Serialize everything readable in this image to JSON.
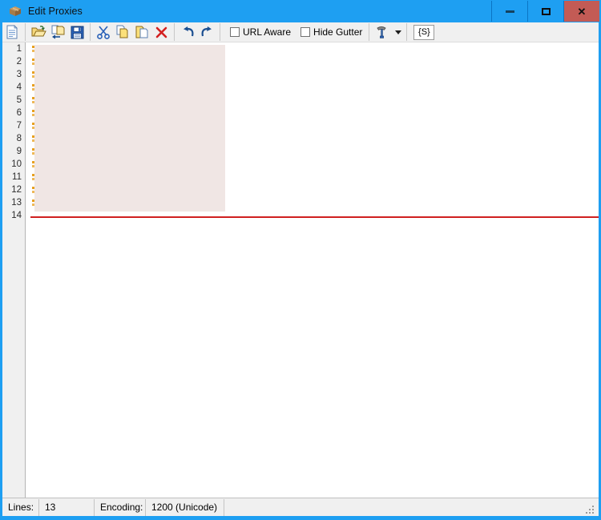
{
  "window": {
    "title": "Edit Proxies",
    "icon": "package-box-icon",
    "accent_color": "#1e9ff2",
    "close_button_color": "#c35b55",
    "controls": {
      "minimize": "–",
      "maximize": "□",
      "close": "✕"
    }
  },
  "toolbar": {
    "buttons": [
      {
        "name": "new-file",
        "icon": "new-document-icon"
      },
      {
        "name": "open-file",
        "icon": "open-folder-icon"
      },
      {
        "name": "import-file",
        "icon": "import-document-icon"
      },
      {
        "name": "save-file",
        "icon": "floppy-disk-save-icon"
      },
      {
        "name": "cut",
        "icon": "scissors-icon"
      },
      {
        "name": "copy",
        "icon": "copy-pages-icon"
      },
      {
        "name": "paste",
        "icon": "clipboard-paste-icon"
      },
      {
        "name": "delete",
        "icon": "red-x-delete-icon"
      },
      {
        "name": "undo",
        "icon": "undo-arrow-icon"
      },
      {
        "name": "redo",
        "icon": "redo-arrow-icon"
      }
    ],
    "checkboxes": [
      {
        "name": "url-aware",
        "label": "URL Aware",
        "checked": false
      },
      {
        "name": "hide-gutter",
        "label": "Hide Gutter",
        "checked": false
      }
    ],
    "tools_menu": {
      "name": "tools-hammer",
      "icon": "hammer-icon"
    },
    "script_button": {
      "name": "script-button",
      "label": "{S}"
    }
  },
  "editor": {
    "gutter": {
      "lines": [
        "1",
        "2",
        "3",
        "4",
        "5",
        "6",
        "7",
        "8",
        "9",
        "10",
        "11",
        "12",
        "13",
        "14"
      ]
    },
    "selection_color": "#f0e6e4",
    "marker_color": "#e8a020",
    "rule_color": "#d02020",
    "content_lines": 13,
    "text": ""
  },
  "statusbar": {
    "lines_label": "Lines:",
    "lines_value": "13",
    "encoding_label": "Encoding:",
    "encoding_value": "1200  (Unicode)"
  }
}
